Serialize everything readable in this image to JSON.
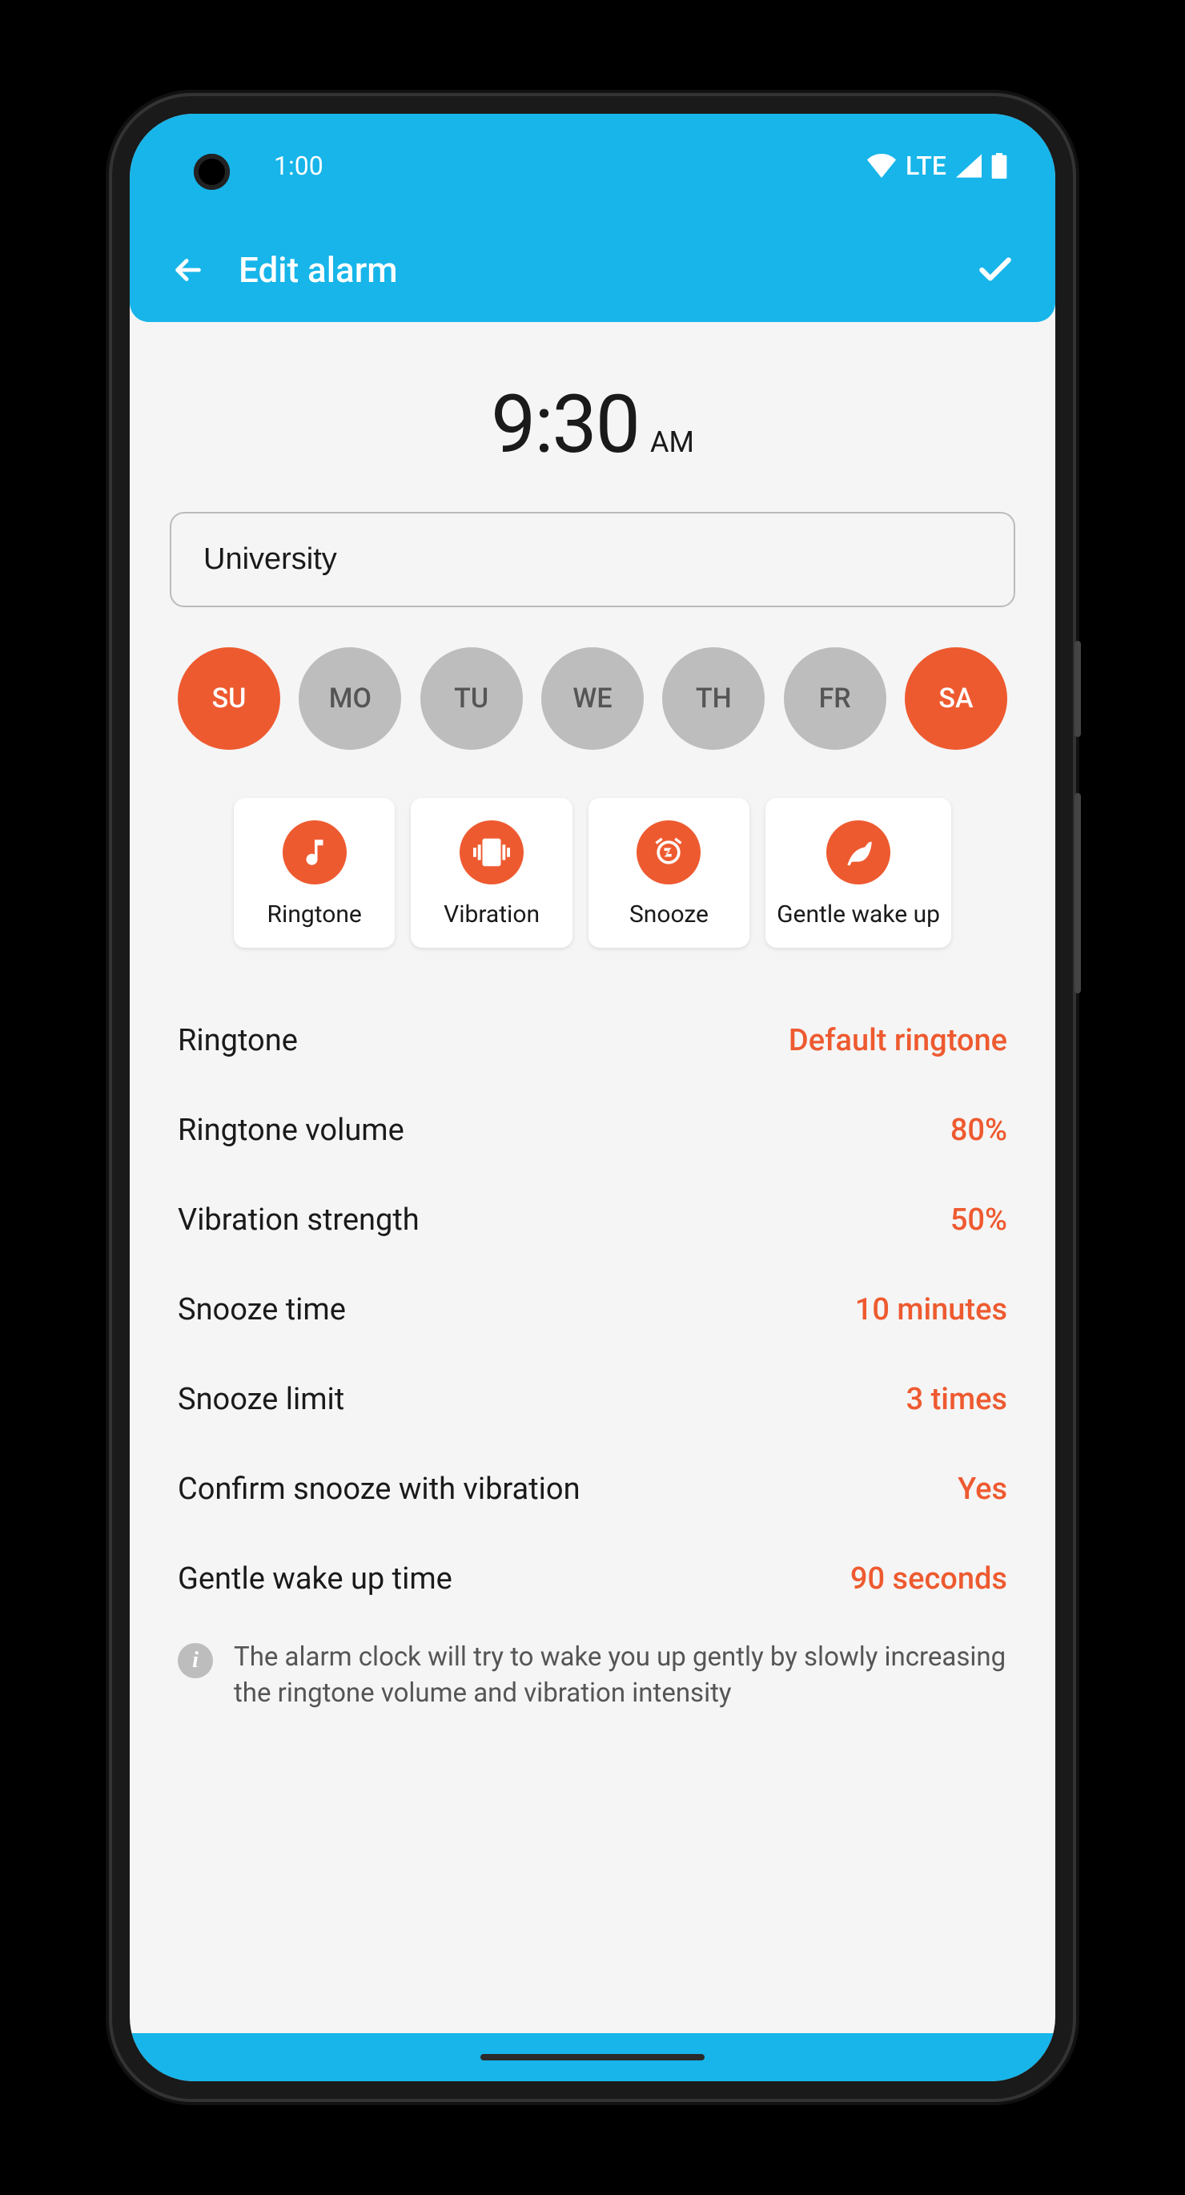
{
  "status": {
    "time": "1:00",
    "network": "LTE"
  },
  "header": {
    "title": "Edit alarm"
  },
  "alarm": {
    "time": "9:30",
    "period": "AM",
    "name": "University"
  },
  "days": [
    {
      "label": "SU",
      "active": true
    },
    {
      "label": "MO",
      "active": false
    },
    {
      "label": "TU",
      "active": false
    },
    {
      "label": "WE",
      "active": false
    },
    {
      "label": "TH",
      "active": false
    },
    {
      "label": "FR",
      "active": false
    },
    {
      "label": "SA",
      "active": true
    }
  ],
  "features": [
    {
      "label": "Ringtone",
      "icon": "note"
    },
    {
      "label": "Vibration",
      "icon": "vibration"
    },
    {
      "label": "Snooze",
      "icon": "snooze"
    },
    {
      "label": "Gentle wake up",
      "icon": "leaf"
    }
  ],
  "settings": [
    {
      "label": "Ringtone",
      "value": "Default ringtone"
    },
    {
      "label": "Ringtone volume",
      "value": "80%"
    },
    {
      "label": "Vibration strength",
      "value": "50%"
    },
    {
      "label": "Snooze time",
      "value": "10 minutes"
    },
    {
      "label": "Snooze limit",
      "value": "3 times"
    },
    {
      "label": "Confirm snooze with vibration",
      "value": "Yes"
    },
    {
      "label": "Gentle wake up time",
      "value": "90 seconds"
    }
  ],
  "info": "The alarm clock will try to wake you up gently by slowly increasing the ringtone volume and vibration intensity"
}
